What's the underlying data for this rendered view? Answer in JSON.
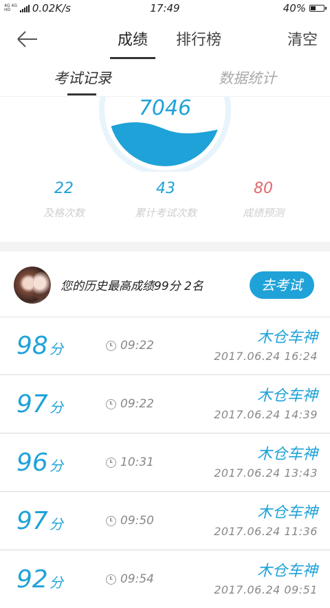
{
  "status_bar": {
    "net_label_top": "4G 4G",
    "net_label_bottom": "HD",
    "speed": "0.02K/s",
    "time": "17:49",
    "battery": "40%",
    "battery_level": 0.4
  },
  "nav": {
    "tabs": [
      {
        "label": "成绩"
      },
      {
        "label": "排行榜"
      }
    ],
    "clear_label": "清空"
  },
  "subtabs": [
    {
      "label": "考试记录"
    },
    {
      "label": "数据统计"
    }
  ],
  "gauge": {
    "value": "7046",
    "fill_color": "#1fa2d8",
    "ring_color": "#e8f4fb"
  },
  "stats": [
    {
      "value": "22",
      "label": "及格次数"
    },
    {
      "value": "43",
      "label": "累计考试次数"
    },
    {
      "value": "80",
      "label": "成绩预测"
    }
  ],
  "profile": {
    "summary": "您的历史最高成绩99分 2名",
    "exam_button": "去考试"
  },
  "records": [
    {
      "score": "98",
      "unit": "分",
      "duration": "09:22",
      "name": "木仓车神",
      "date": "2017.06.24  16:24"
    },
    {
      "score": "97",
      "unit": "分",
      "duration": "09:22",
      "name": "木仓车神",
      "date": "2017.06.24  14:39"
    },
    {
      "score": "96",
      "unit": "分",
      "duration": "10:31",
      "name": "木仓车神",
      "date": "2017.06.24  13:43"
    },
    {
      "score": "97",
      "unit": "分",
      "duration": "09:50",
      "name": "木仓车神",
      "date": "2017.06.24  11:36"
    },
    {
      "score": "92",
      "unit": "分",
      "duration": "09:54",
      "name": "木仓车神",
      "date": "2017.06.24  09:51"
    }
  ]
}
